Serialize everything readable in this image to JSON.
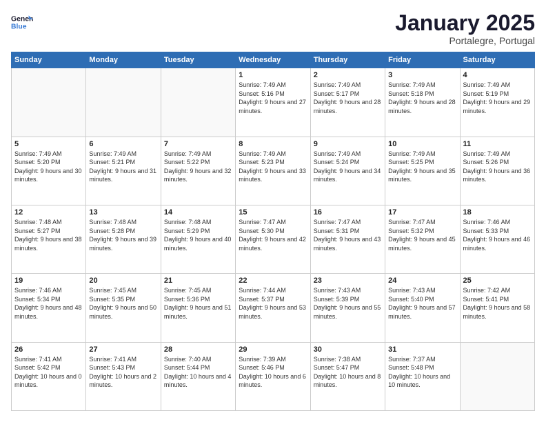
{
  "logo": {
    "general": "General",
    "blue": "Blue"
  },
  "title": "January 2025",
  "subtitle": "Portalegre, Portugal",
  "days": [
    "Sunday",
    "Monday",
    "Tuesday",
    "Wednesday",
    "Thursday",
    "Friday",
    "Saturday"
  ],
  "weeks": [
    [
      {
        "day": "",
        "info": ""
      },
      {
        "day": "",
        "info": ""
      },
      {
        "day": "",
        "info": ""
      },
      {
        "day": "1",
        "info": "Sunrise: 7:49 AM\nSunset: 5:16 PM\nDaylight: 9 hours and 27 minutes."
      },
      {
        "day": "2",
        "info": "Sunrise: 7:49 AM\nSunset: 5:17 PM\nDaylight: 9 hours and 28 minutes."
      },
      {
        "day": "3",
        "info": "Sunrise: 7:49 AM\nSunset: 5:18 PM\nDaylight: 9 hours and 28 minutes."
      },
      {
        "day": "4",
        "info": "Sunrise: 7:49 AM\nSunset: 5:19 PM\nDaylight: 9 hours and 29 minutes."
      }
    ],
    [
      {
        "day": "5",
        "info": "Sunrise: 7:49 AM\nSunset: 5:20 PM\nDaylight: 9 hours and 30 minutes."
      },
      {
        "day": "6",
        "info": "Sunrise: 7:49 AM\nSunset: 5:21 PM\nDaylight: 9 hours and 31 minutes."
      },
      {
        "day": "7",
        "info": "Sunrise: 7:49 AM\nSunset: 5:22 PM\nDaylight: 9 hours and 32 minutes."
      },
      {
        "day": "8",
        "info": "Sunrise: 7:49 AM\nSunset: 5:23 PM\nDaylight: 9 hours and 33 minutes."
      },
      {
        "day": "9",
        "info": "Sunrise: 7:49 AM\nSunset: 5:24 PM\nDaylight: 9 hours and 34 minutes."
      },
      {
        "day": "10",
        "info": "Sunrise: 7:49 AM\nSunset: 5:25 PM\nDaylight: 9 hours and 35 minutes."
      },
      {
        "day": "11",
        "info": "Sunrise: 7:49 AM\nSunset: 5:26 PM\nDaylight: 9 hours and 36 minutes."
      }
    ],
    [
      {
        "day": "12",
        "info": "Sunrise: 7:48 AM\nSunset: 5:27 PM\nDaylight: 9 hours and 38 minutes."
      },
      {
        "day": "13",
        "info": "Sunrise: 7:48 AM\nSunset: 5:28 PM\nDaylight: 9 hours and 39 minutes."
      },
      {
        "day": "14",
        "info": "Sunrise: 7:48 AM\nSunset: 5:29 PM\nDaylight: 9 hours and 40 minutes."
      },
      {
        "day": "15",
        "info": "Sunrise: 7:47 AM\nSunset: 5:30 PM\nDaylight: 9 hours and 42 minutes."
      },
      {
        "day": "16",
        "info": "Sunrise: 7:47 AM\nSunset: 5:31 PM\nDaylight: 9 hours and 43 minutes."
      },
      {
        "day": "17",
        "info": "Sunrise: 7:47 AM\nSunset: 5:32 PM\nDaylight: 9 hours and 45 minutes."
      },
      {
        "day": "18",
        "info": "Sunrise: 7:46 AM\nSunset: 5:33 PM\nDaylight: 9 hours and 46 minutes."
      }
    ],
    [
      {
        "day": "19",
        "info": "Sunrise: 7:46 AM\nSunset: 5:34 PM\nDaylight: 9 hours and 48 minutes."
      },
      {
        "day": "20",
        "info": "Sunrise: 7:45 AM\nSunset: 5:35 PM\nDaylight: 9 hours and 50 minutes."
      },
      {
        "day": "21",
        "info": "Sunrise: 7:45 AM\nSunset: 5:36 PM\nDaylight: 9 hours and 51 minutes."
      },
      {
        "day": "22",
        "info": "Sunrise: 7:44 AM\nSunset: 5:37 PM\nDaylight: 9 hours and 53 minutes."
      },
      {
        "day": "23",
        "info": "Sunrise: 7:43 AM\nSunset: 5:39 PM\nDaylight: 9 hours and 55 minutes."
      },
      {
        "day": "24",
        "info": "Sunrise: 7:43 AM\nSunset: 5:40 PM\nDaylight: 9 hours and 57 minutes."
      },
      {
        "day": "25",
        "info": "Sunrise: 7:42 AM\nSunset: 5:41 PM\nDaylight: 9 hours and 58 minutes."
      }
    ],
    [
      {
        "day": "26",
        "info": "Sunrise: 7:41 AM\nSunset: 5:42 PM\nDaylight: 10 hours and 0 minutes."
      },
      {
        "day": "27",
        "info": "Sunrise: 7:41 AM\nSunset: 5:43 PM\nDaylight: 10 hours and 2 minutes."
      },
      {
        "day": "28",
        "info": "Sunrise: 7:40 AM\nSunset: 5:44 PM\nDaylight: 10 hours and 4 minutes."
      },
      {
        "day": "29",
        "info": "Sunrise: 7:39 AM\nSunset: 5:46 PM\nDaylight: 10 hours and 6 minutes."
      },
      {
        "day": "30",
        "info": "Sunrise: 7:38 AM\nSunset: 5:47 PM\nDaylight: 10 hours and 8 minutes."
      },
      {
        "day": "31",
        "info": "Sunrise: 7:37 AM\nSunset: 5:48 PM\nDaylight: 10 hours and 10 minutes."
      },
      {
        "day": "",
        "info": ""
      }
    ]
  ]
}
